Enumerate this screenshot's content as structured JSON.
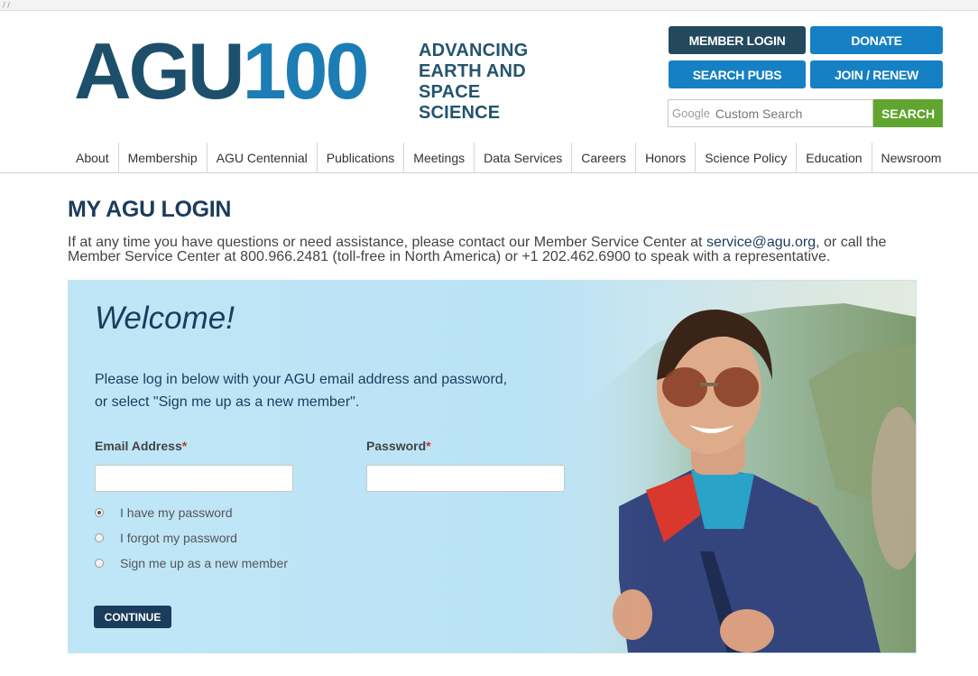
{
  "topbar": {
    "mark": "/ /"
  },
  "logo": {
    "agu": "AGU",
    "num": "100",
    "tagline": [
      "ADVANCING",
      "EARTH AND",
      "SPACE SCIENCE"
    ]
  },
  "header_buttons": {
    "member_login": "MEMBER LOGIN",
    "donate": "DONATE",
    "search_pubs": "SEARCH PUBS",
    "join_renew": "JOIN / RENEW"
  },
  "search": {
    "watermark": "Google",
    "placeholder": "Custom Search",
    "button": "SEARCH"
  },
  "nav": [
    "About",
    "Membership",
    "AGU Centennial",
    "Publications",
    "Meetings",
    "Data Services",
    "Careers",
    "Honors",
    "Science Policy",
    "Education",
    "Newsroom"
  ],
  "page": {
    "title": "MY AGU LOGIN",
    "intro_pre": "If at any time you have questions or need assistance, please contact our Member Service Center at ",
    "intro_email": "service@agu.org",
    "intro_post": ", or call the Member Service Center at 800.966.2481 (toll-free in North America) or +1 202.462.6900 to speak with a representative."
  },
  "login": {
    "welcome": "Welcome!",
    "lead_1": "Please log in below with your AGU email address and password,",
    "lead_2": "or select \"Sign me up as a new member\".",
    "email_label": "Email Address",
    "password_label": "Password",
    "required_mark": "*",
    "email_value": "",
    "password_value": "",
    "options": [
      "I have my password",
      "I forgot my password",
      "Sign me up as a new member"
    ],
    "selected_option": 0,
    "continue": "CONTINUE"
  },
  "colors": {
    "brand_dark": "#24485e",
    "brand_blue": "#1680c4",
    "search_green": "#5fa530",
    "heading_navy": "#1b3c5c",
    "panel_bg": "#bfe6f7"
  }
}
